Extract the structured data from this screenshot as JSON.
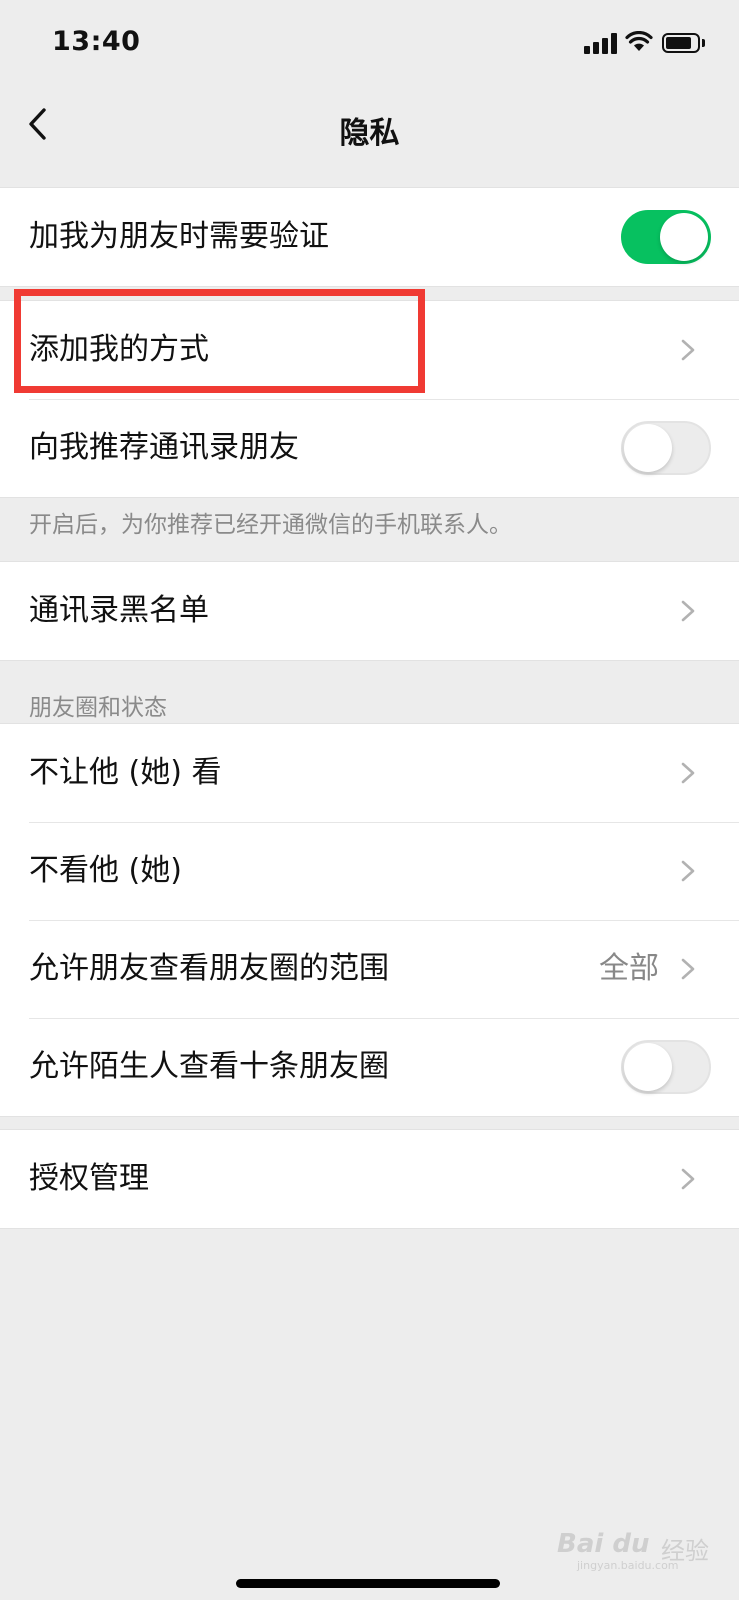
{
  "status_bar": {
    "time": "13:40",
    "icons": [
      "cellular-signal-icon",
      "wifi-icon",
      "battery-icon"
    ]
  },
  "nav": {
    "title": "隐私",
    "back_icon": "chevron-left-icon"
  },
  "groups": {
    "verify": {
      "label": "加我为朋友时需要验证",
      "toggle_on": true
    },
    "add_me": {
      "items": [
        {
          "label": "添加我的方式"
        },
        {
          "label": "向我推荐通讯录朋友",
          "toggle_on": false
        }
      ],
      "note": "开启后，为你推荐已经开通微信的手机联系人。"
    },
    "blacklist": {
      "label": "通讯录黑名单"
    },
    "moments": {
      "header": "朋友圈和状态",
      "items": [
        {
          "label": "不让他 (她) 看"
        },
        {
          "label": "不看他 (她)"
        },
        {
          "label": "允许朋友查看朋友圈的范围",
          "value": "全部"
        },
        {
          "label": "允许陌生人查看十条朋友圈",
          "toggle_on": false
        }
      ]
    },
    "auth": {
      "label": "授权管理"
    }
  },
  "colors": {
    "toggle_on": "#07c160",
    "highlight": "#f03a33",
    "background": "#ededed"
  },
  "watermark": {
    "logo": "Bai du",
    "name": "经验",
    "domain": "jingyan.baidu.com"
  }
}
